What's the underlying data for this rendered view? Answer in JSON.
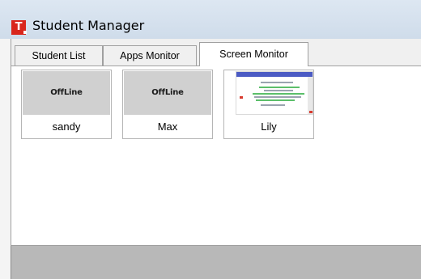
{
  "window": {
    "title": "Student Manager",
    "logo_letter": "T"
  },
  "tabs": [
    {
      "label": "Student List",
      "active": false
    },
    {
      "label": "Apps Monitor",
      "active": false
    },
    {
      "label": "Screen Monitor",
      "active": true
    }
  ],
  "students": [
    {
      "name": "sandy",
      "status": "OffLine"
    },
    {
      "name": "Max",
      "status": "OffLine"
    },
    {
      "name": "Lily",
      "status": ""
    }
  ],
  "colors": {
    "logo": "#d9261c",
    "offline_thumb": "#d0d0d0",
    "bottom_bar": "#b8b8b8"
  }
}
